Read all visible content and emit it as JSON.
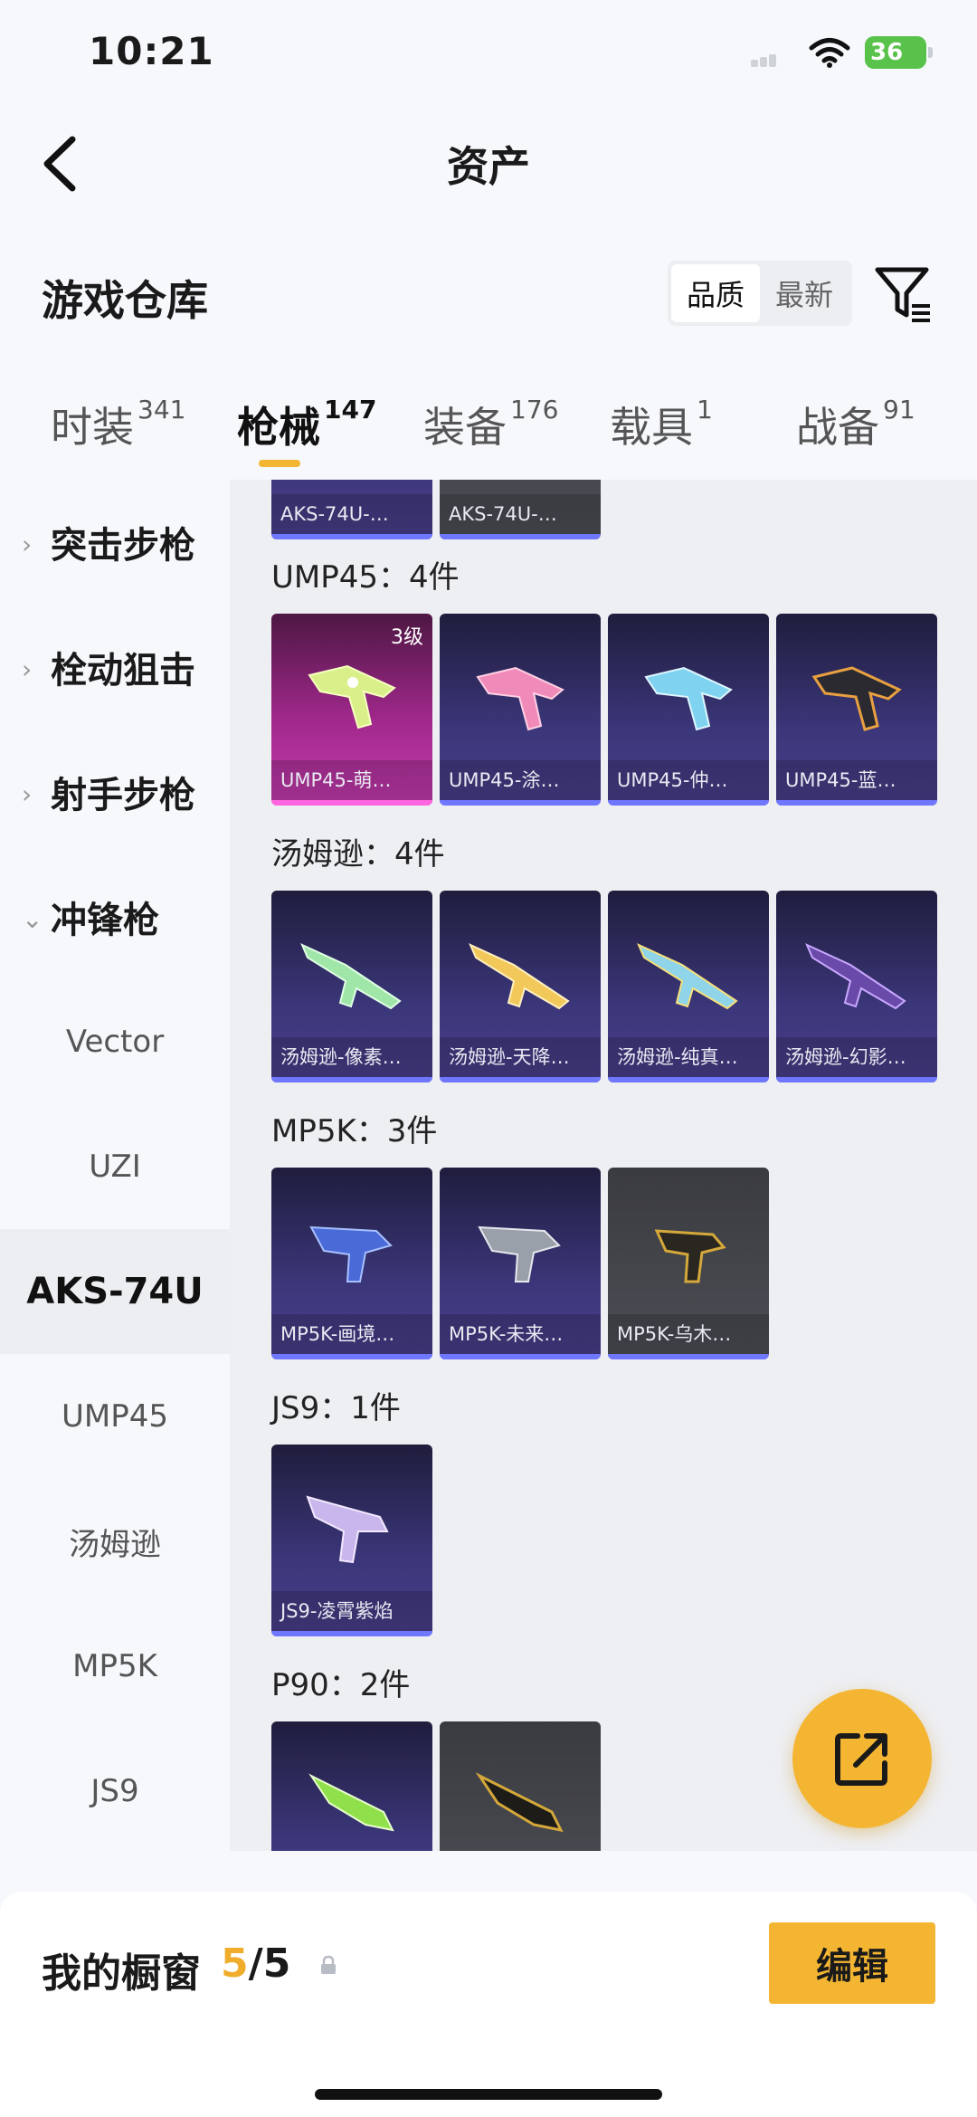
{
  "status": {
    "time": "10:21",
    "battery": "36"
  },
  "nav": {
    "title": "资产"
  },
  "section": {
    "title": "游戏仓库",
    "sort": [
      "品质",
      "最新"
    ]
  },
  "tabs": [
    {
      "label": "时装",
      "count": "341"
    },
    {
      "label": "枪械",
      "count": "147"
    },
    {
      "label": "装备",
      "count": "176"
    },
    {
      "label": "载具",
      "count": "1"
    },
    {
      "label": "战备",
      "count": "91"
    }
  ],
  "sidebar": {
    "categories": [
      "突击步枪",
      "栓动狙击",
      "射手步枪",
      "冲锋枪"
    ],
    "subs": [
      "Vector",
      "UZI",
      "AKS-74U",
      "UMP45",
      "汤姆逊",
      "MP5K",
      "JS9"
    ]
  },
  "groups": {
    "aks": {
      "cards": [
        "AKS-74U-…",
        "AKS-74U-…"
      ]
    },
    "ump": {
      "label": "UMP45：4件",
      "level": "3级",
      "cards": [
        "UMP45-萌…",
        "UMP45-涂…",
        "UMP45-仲…",
        "UMP45-蓝…"
      ]
    },
    "tom": {
      "label": "汤姆逊：4件",
      "cards": [
        "汤姆逊-像素…",
        "汤姆逊-天降…",
        "汤姆逊-纯真…",
        "汤姆逊-幻影…"
      ]
    },
    "mp5k": {
      "label": "MP5K：3件",
      "cards": [
        "MP5K-画境…",
        "MP5K-未来…",
        "MP5K-乌木…"
      ]
    },
    "js9": {
      "label": "JS9：1件",
      "cards": [
        "JS9-凌霄紫焰"
      ]
    },
    "p90": {
      "label": "P90：2件"
    }
  },
  "bottom": {
    "showcase": "我的橱窗",
    "current": "5",
    "total": "/5",
    "edit": "编辑"
  },
  "colors": {
    "accent": "#f4b532",
    "rare_bar": "#6f77ff",
    "legendary": "#c63cb0"
  }
}
